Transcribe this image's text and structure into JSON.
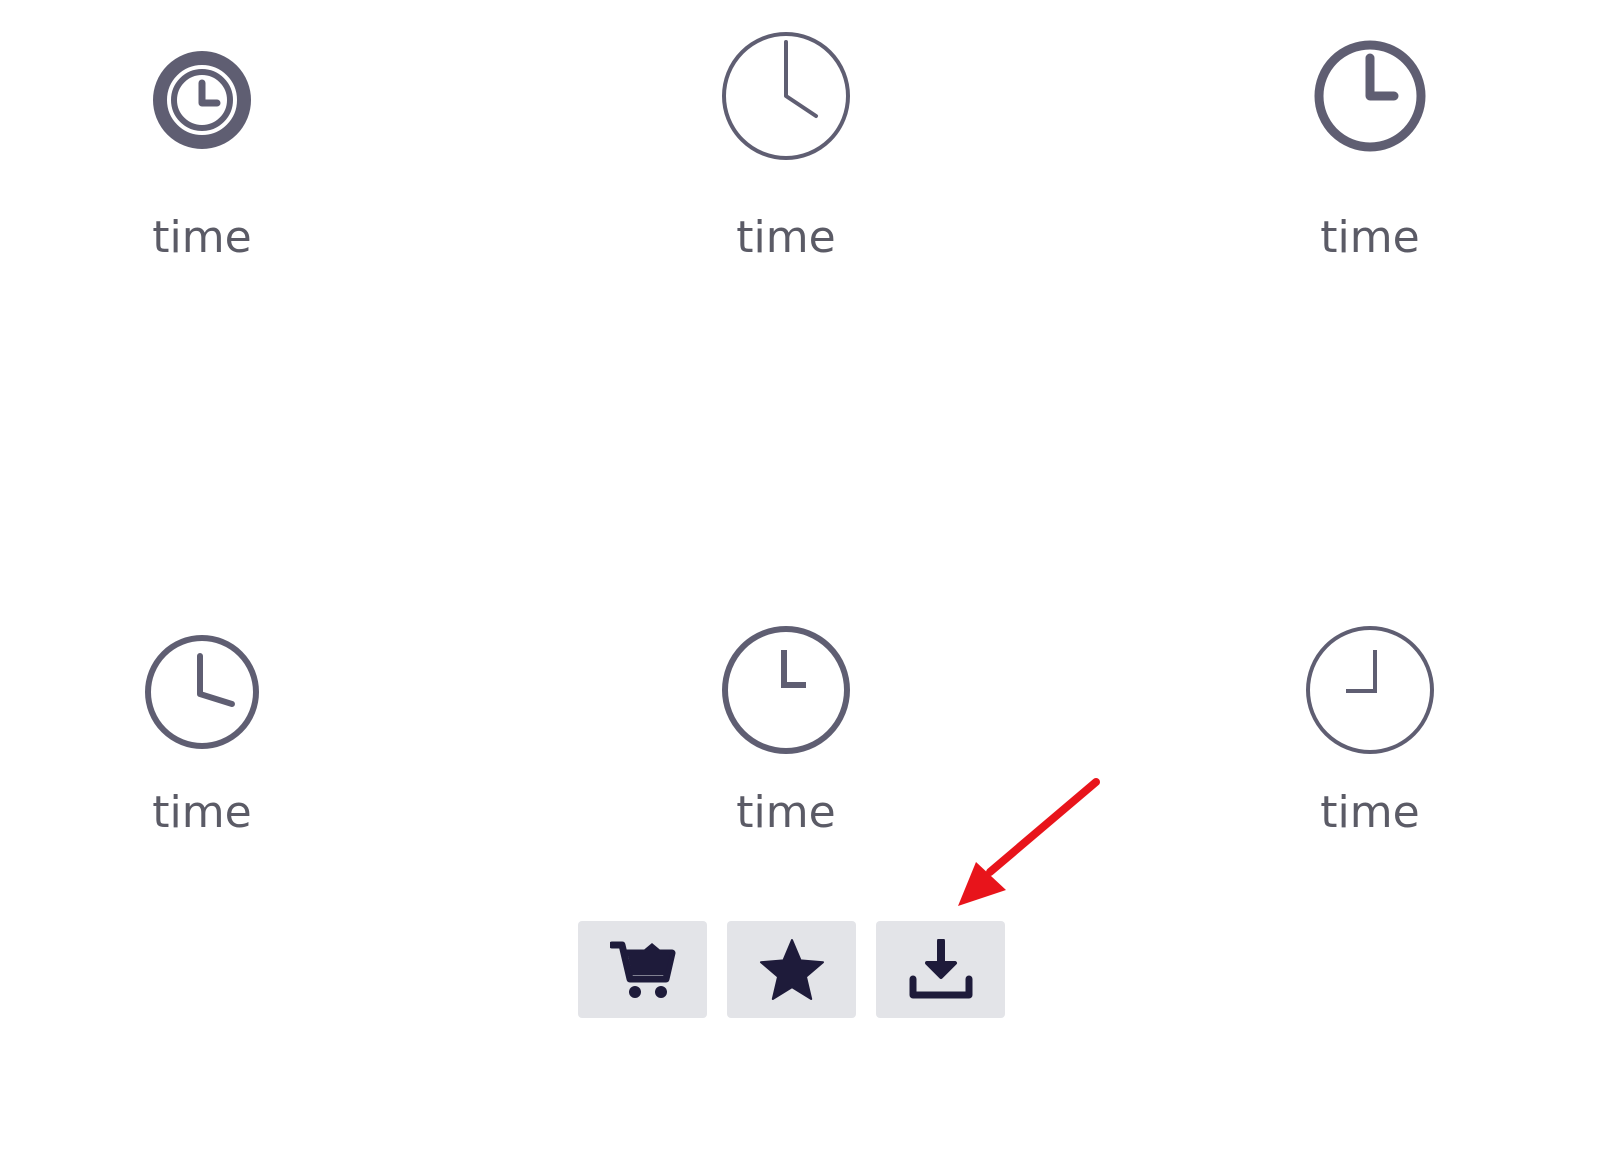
{
  "icons": [
    {
      "label": "time",
      "icon": "clock-filled-ring-icon"
    },
    {
      "label": "time",
      "icon": "clock-thin-outline-icon"
    },
    {
      "label": "time",
      "icon": "clock-bold-outline-icon"
    },
    {
      "label": "time",
      "icon": "clock-medium-outline-icon"
    },
    {
      "label": "time",
      "icon": "clock-outline-nine-icon"
    },
    {
      "label": "time",
      "icon": "clock-outline-three-icon"
    }
  ],
  "actions": [
    {
      "icon": "cart-icon"
    },
    {
      "icon": "star-icon"
    },
    {
      "icon": "download-icon"
    }
  ],
  "colors": {
    "icon_gray": "#5f5e72",
    "label_gray": "#5b5b66",
    "button_bg": "#e3e4e8",
    "button_icon": "#1e1b3a",
    "annotation_red": "#e8141b"
  }
}
